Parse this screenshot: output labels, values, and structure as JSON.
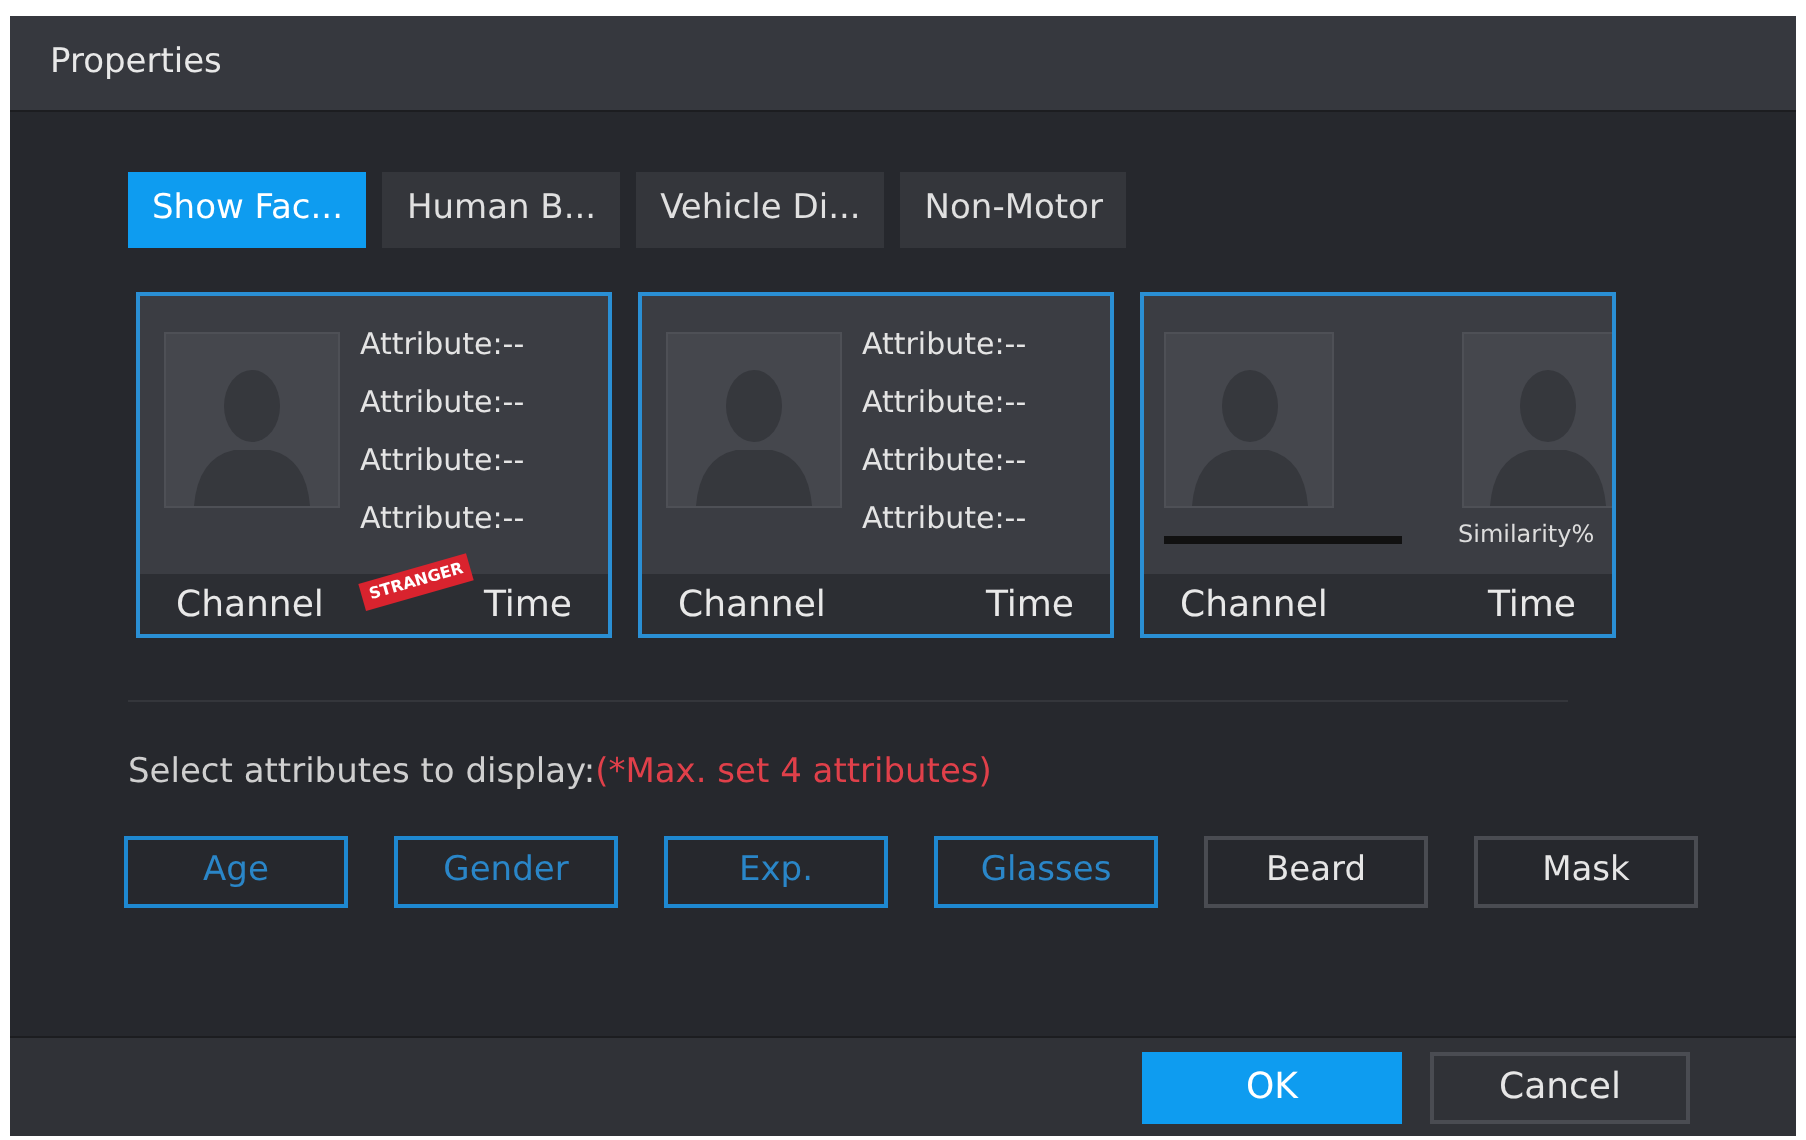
{
  "window": {
    "title": "Properties"
  },
  "tabs": [
    {
      "label": "Show Fac...",
      "selected": true
    },
    {
      "label": "Human B...",
      "selected": false
    },
    {
      "label": "Vehicle Di...",
      "selected": false
    },
    {
      "label": "Non-Motor",
      "selected": false
    }
  ],
  "cards": [
    {
      "kind": "attributes",
      "attributes": [
        "Attribute:--",
        "Attribute:--",
        "Attribute:--",
        "Attribute:--"
      ],
      "stamp": "STRANGER",
      "channel": "Channel",
      "time": "Time"
    },
    {
      "kind": "attributes",
      "attributes": [
        "Attribute:--",
        "Attribute:--",
        "Attribute:--",
        "Attribute:--"
      ],
      "channel": "Channel",
      "time": "Time"
    },
    {
      "kind": "compare",
      "similarity": "Similarity%",
      "channel": "Channel",
      "time": "Time"
    }
  ],
  "prompt": {
    "text": "Select attributes to display:",
    "note": "(*Max. set 4 attributes)"
  },
  "attribute_buttons": [
    {
      "label": "Age",
      "selected": true
    },
    {
      "label": "Gender",
      "selected": true
    },
    {
      "label": "Exp.",
      "selected": true
    },
    {
      "label": "Glasses",
      "selected": true
    },
    {
      "label": "Beard",
      "selected": false
    },
    {
      "label": "Mask",
      "selected": false
    }
  ],
  "buttons": [
    {
      "label": "OK",
      "kind": "primary"
    },
    {
      "label": "Cancel",
      "kind": "secondary"
    }
  ]
}
